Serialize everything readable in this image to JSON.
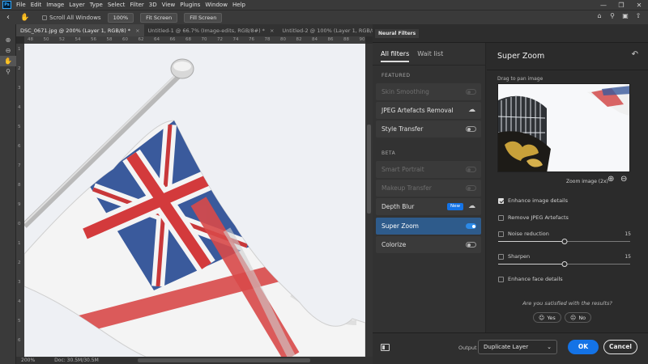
{
  "app": {
    "logo": "Ps"
  },
  "menu": [
    "File",
    "Edit",
    "Image",
    "Layer",
    "Type",
    "Select",
    "Filter",
    "3D",
    "View",
    "Plugins",
    "Window",
    "Help"
  ],
  "options_bar": {
    "scroll_all_windows": "Scroll All Windows",
    "zoom_100": "100%",
    "fit_screen": "Fit Screen",
    "fill_screen": "Fill Screen"
  },
  "doc_tabs": [
    {
      "label": "DSC_0671.jpg @ 200% (Layer 1, RGB/8) *",
      "active": true
    },
    {
      "label": "Untitled-1 @ 66.7% (Image-edits, RGB/8#) *",
      "active": false
    },
    {
      "label": "Untitled-2 @ 100% (Layer 1, RGB/8#) *",
      "active": false
    }
  ],
  "ruler": {
    "top": [
      "48",
      "50",
      "52",
      "54",
      "56",
      "58",
      "60",
      "62",
      "64",
      "66",
      "68",
      "70",
      "72",
      "74",
      "76",
      "78",
      "80",
      "82",
      "84",
      "86",
      "88",
      "90"
    ],
    "left": [
      "1",
      "2",
      "3",
      "4",
      "5",
      "6",
      "7",
      "8",
      "9",
      "0",
      "1",
      "2",
      "3",
      "4",
      "5",
      "6"
    ]
  },
  "status": {
    "zoom": "200%",
    "doc": "Doc: 30.5M/30.5M"
  },
  "neural_filters": {
    "panel_tab": "Neural Filters",
    "tabs": [
      "All filters",
      "Wait list"
    ],
    "featured_label": "FEATURED",
    "beta_label": "BETA",
    "featured": [
      {
        "name": "Skin Smoothing",
        "state": "disabled"
      },
      {
        "name": "JPEG Artefacts Removal",
        "state": "cloud"
      },
      {
        "name": "Style Transfer",
        "state": "off"
      }
    ],
    "beta": [
      {
        "name": "Smart Portrait",
        "state": "disabled"
      },
      {
        "name": "Makeup Transfer",
        "state": "disabled"
      },
      {
        "name": "Depth Blur",
        "state": "cloud",
        "badge": "New"
      },
      {
        "name": "Super Zoom",
        "state": "on",
        "selected": true
      },
      {
        "name": "Colorize",
        "state": "off"
      }
    ]
  },
  "settings": {
    "title": "Super Zoom",
    "drag_label": "Drag to pan image",
    "zoom_label": "Zoom image (2x)",
    "enhance_details": "Enhance image details",
    "remove_jpeg": "Remove JPEG Artefacts",
    "noise_reduction": "Noise reduction",
    "noise_value": "15",
    "noise_fraction": 0.5,
    "sharpen": "Sharpen",
    "sharpen_value": "15",
    "sharpen_fraction": 0.5,
    "enhance_face": "Enhance face details",
    "feedback_question": "Are you satisfied with the results?",
    "yes": "Yes",
    "no": "No"
  },
  "footer": {
    "output_label": "Output",
    "output_value": "Duplicate Layer",
    "ok": "OK",
    "cancel": "Cancel"
  },
  "colors": {
    "accent": "#1473e6",
    "selected_row": "#2e5b8b",
    "toggle_on": "#2c8ae8"
  }
}
